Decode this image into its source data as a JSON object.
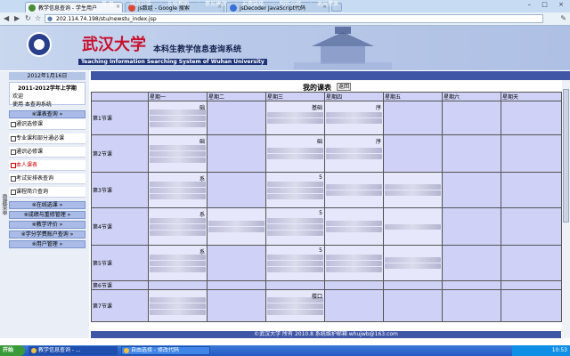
{
  "browser": {
    "tabs": [
      {
        "label": "教学信息查询 - 学生用户",
        "color": "#4a8c3a"
      },
      {
        "label": "js数组 - Google 搜索",
        "color": "#d64a3a"
      },
      {
        "label": "jsDecoder JavaScript代码",
        "color": "#3a6fd6"
      }
    ],
    "url": "202.114.74.198/stu/newstu_index.jsp",
    "window_controls": "– □ ×"
  },
  "banner": {
    "university": "武汉大学",
    "system_cn": "本科生教学信息查询系统",
    "system_en": "Teaching Information Searching System of Wuhan University"
  },
  "sidebar": {
    "date": "2012年1月16日",
    "term": "2011-2012学年上学期",
    "welcome": "欢迎",
    "use_text": "使用 本查询系统",
    "toggle": "隐藏菜单",
    "sections": [
      {
        "label": "※课表查询 »"
      },
      {
        "label": "※在线选课 »"
      },
      {
        "label": "※成绩与重修管理 »"
      },
      {
        "label": "※教学评价 »"
      },
      {
        "label": "※学分学费账户查询 »"
      },
      {
        "label": "※用户管理 »"
      }
    ],
    "items": [
      {
        "label": "通识选修课"
      },
      {
        "label": "专业课和部分通必课"
      },
      {
        "label": "通识必修课"
      },
      {
        "label": "本人课表"
      },
      {
        "label": "考试安排表查询"
      },
      {
        "label": "课程简介查询"
      }
    ]
  },
  "navbar": {
    "links": [
      "首 页",
      "站点公告",
      "在线帮助",
      "意见建议",
      "友情链接",
      "制作小组",
      "退出登录"
    ]
  },
  "timetable": {
    "title": "我的课表",
    "back": "返回",
    "days": [
      "星期一",
      "星期二",
      "星期三",
      "星期四",
      "星期五",
      "星期六",
      "星期天"
    ],
    "periods": [
      "第1节课",
      "第2节课",
      "第3节课",
      "第4节课",
      "第5节课",
      "第6节课",
      "第7节课"
    ],
    "cells": {
      "r0c0": "础",
      "r0c2": "基础",
      "r1c0": "础",
      "r1c2": "础",
      "r1c3": "序",
      "r2c0": "系",
      "r2c2": "5",
      "r3c0": "系",
      "r3c2": "5",
      "r4c0": "系",
      "r4c2": "5",
      "r6c2": "楼口",
      "r0c3": "序"
    }
  },
  "footer": {
    "text": "©武汉大学 所有 2010.8 系统维护邮箱 whujwb@163.com"
  },
  "taskbar": {
    "start": "开始",
    "items": [
      "教学信息查询 - ...",
      "自由选择 - 修改代码"
    ],
    "tray": "10:53"
  }
}
